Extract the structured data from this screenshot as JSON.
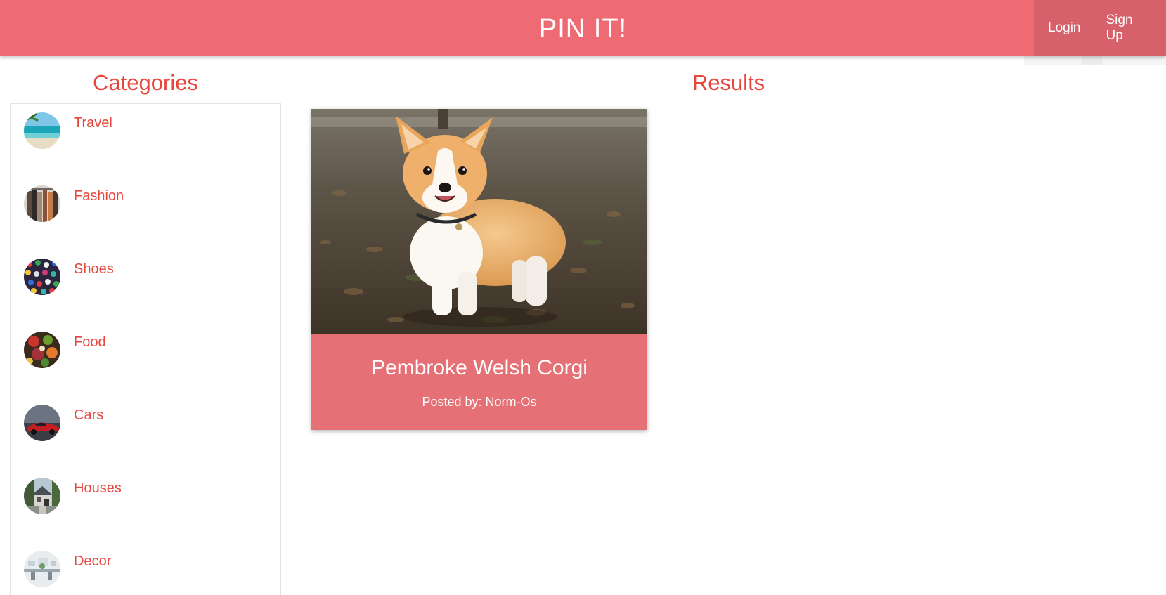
{
  "navbar": {
    "brand": "PIN IT!",
    "login_label": "Login",
    "signup_label": "Sign Up"
  },
  "sidebar": {
    "heading": "Categories",
    "items": [
      {
        "label": "Travel",
        "icon": "travel-thumbnail"
      },
      {
        "label": "Fashion",
        "icon": "fashion-thumbnail"
      },
      {
        "label": "Shoes",
        "icon": "shoes-thumbnail"
      },
      {
        "label": "Food",
        "icon": "food-thumbnail"
      },
      {
        "label": "Cars",
        "icon": "cars-thumbnail"
      },
      {
        "label": "Houses",
        "icon": "houses-thumbnail"
      },
      {
        "label": "Decor",
        "icon": "decor-thumbnail"
      }
    ]
  },
  "results": {
    "heading": "Results",
    "cards": [
      {
        "title": "Pembroke Welsh Corgi",
        "posted_by": "Posted by: Norm-Os",
        "image": "corgi-photo"
      }
    ]
  },
  "colors": {
    "navbar": "#ef6b73",
    "navbar_right": "#d6616a",
    "accent_text": "#e8453c",
    "card_body": "#e57076"
  }
}
